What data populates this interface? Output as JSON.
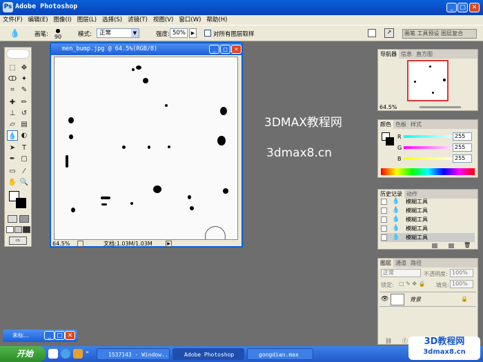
{
  "app": {
    "title": "Adobe Photoshop"
  },
  "menu": [
    "文件(F)",
    "编辑(E)",
    "图像(I)",
    "图层(L)",
    "选择(S)",
    "滤镜(T)",
    "视图(V)",
    "窗口(W)",
    "帮助(H)"
  ],
  "options": {
    "brush_label": "画笔:",
    "brush_size": "90",
    "mode_label": "模式:",
    "mode_value": "正常",
    "strength_label": "强度:",
    "strength_value": "50%",
    "sample_all_label": "对所有图层取样",
    "palette_tabs": "画笔 工具预设 图层复合"
  },
  "document": {
    "title": "men_bump.jpg @ 64.5%(RGB/8)",
    "zoom": "64.5%",
    "status": "文档:1.03M/1.03M"
  },
  "overlay": {
    "line1": "3DMAX教程网",
    "line2": "3dmax8.cn"
  },
  "navigator": {
    "tabs": [
      "导航器",
      "信息",
      "直方图"
    ],
    "zoom": "64.5%"
  },
  "color": {
    "tabs": [
      "颜色",
      "色板",
      "样式"
    ],
    "r_label": "R",
    "g_label": "G",
    "b_label": "B",
    "r": "255",
    "g": "255",
    "b": "255"
  },
  "history": {
    "tabs": [
      "历史记录",
      "动作"
    ],
    "items": [
      "模糊工具",
      "模糊工具",
      "模糊工具",
      "模糊工具",
      "模糊工具"
    ]
  },
  "layers": {
    "tabs": [
      "图层",
      "通道",
      "路径"
    ],
    "blend": "正常",
    "opacity_label": "不透明度:",
    "opacity": "100%",
    "lock_label": "锁定:",
    "fill_label": "填充:",
    "fill": "100%",
    "layer_name": "背景"
  },
  "minimized": {
    "label": "未标..."
  },
  "taskbar": {
    "start": "开始",
    "tasks": [
      "1537143 - Window...",
      "Adobe Photoshop",
      "gongdian.max"
    ]
  },
  "watermark": {
    "line1": "3D教程网",
    "line2": "3dmax8.cn"
  }
}
